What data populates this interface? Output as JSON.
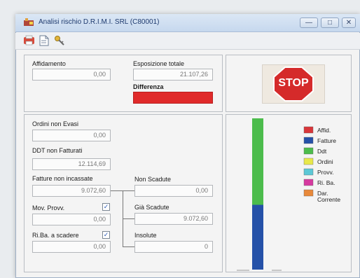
{
  "window": {
    "title": "Analisi rischio D.R.I.M.I. SRL (C80001)",
    "controls": [
      "—",
      "□",
      "✕"
    ]
  },
  "toolbar": {
    "icons": [
      "print-icon",
      "document-icon",
      "key-icon"
    ]
  },
  "exposure": {
    "affidamento_label": "Affidamento",
    "affidamento_value": "0,00",
    "esposizione_label": "Esposizione totale",
    "esposizione_value": "21.107,26",
    "differenza_label": "Differenza",
    "differenza_value": "",
    "stop_text": "STOP"
  },
  "details": {
    "ordini_label": "Ordini non Evasi",
    "ordini_value": "0,00",
    "ddt_label": "DDT non Fatturati",
    "ddt_value": "12.114,69",
    "fatture_label": "Fatture non incassate",
    "fatture_value": "9.072,60",
    "mov_label": "Mov. Provv.",
    "mov_value": "0,00",
    "riba_label": "Ri.Ba. a scadere",
    "riba_value": "0,00",
    "nonscad_label": "Non Scadute",
    "nonscad_value": "0,00",
    "giascad_label": "Già Scadute",
    "giascad_value": "9.072,60",
    "insolute_label": "Insolute",
    "insolute_value": "0"
  },
  "colors": {
    "green": "#4cbc4c",
    "blue": "#2551a8",
    "red_alert": "#e02a2a"
  },
  "chart_data": {
    "type": "bar",
    "categories": [
      ""
    ],
    "series": [
      {
        "name": "Fatture",
        "values": [
          9072.6
        ]
      },
      {
        "name": "Ddt",
        "values": [
          12114.69
        ]
      }
    ],
    "legend": {
      "position": "right",
      "items": [
        {
          "label": "Affid.",
          "color": "#d9363a"
        },
        {
          "label": "Fatture",
          "color": "#2551a8"
        },
        {
          "label": "Ddt",
          "color": "#4cbc4c"
        },
        {
          "label": "Ordini",
          "color": "#e8e84a"
        },
        {
          "label": "Provv.",
          "color": "#5cc8d6"
        },
        {
          "label": "Ri. Ba.",
          "color": "#d63aa0"
        },
        {
          "label": "Dar.\nCorrente",
          "color": "#e8893a"
        }
      ]
    }
  }
}
